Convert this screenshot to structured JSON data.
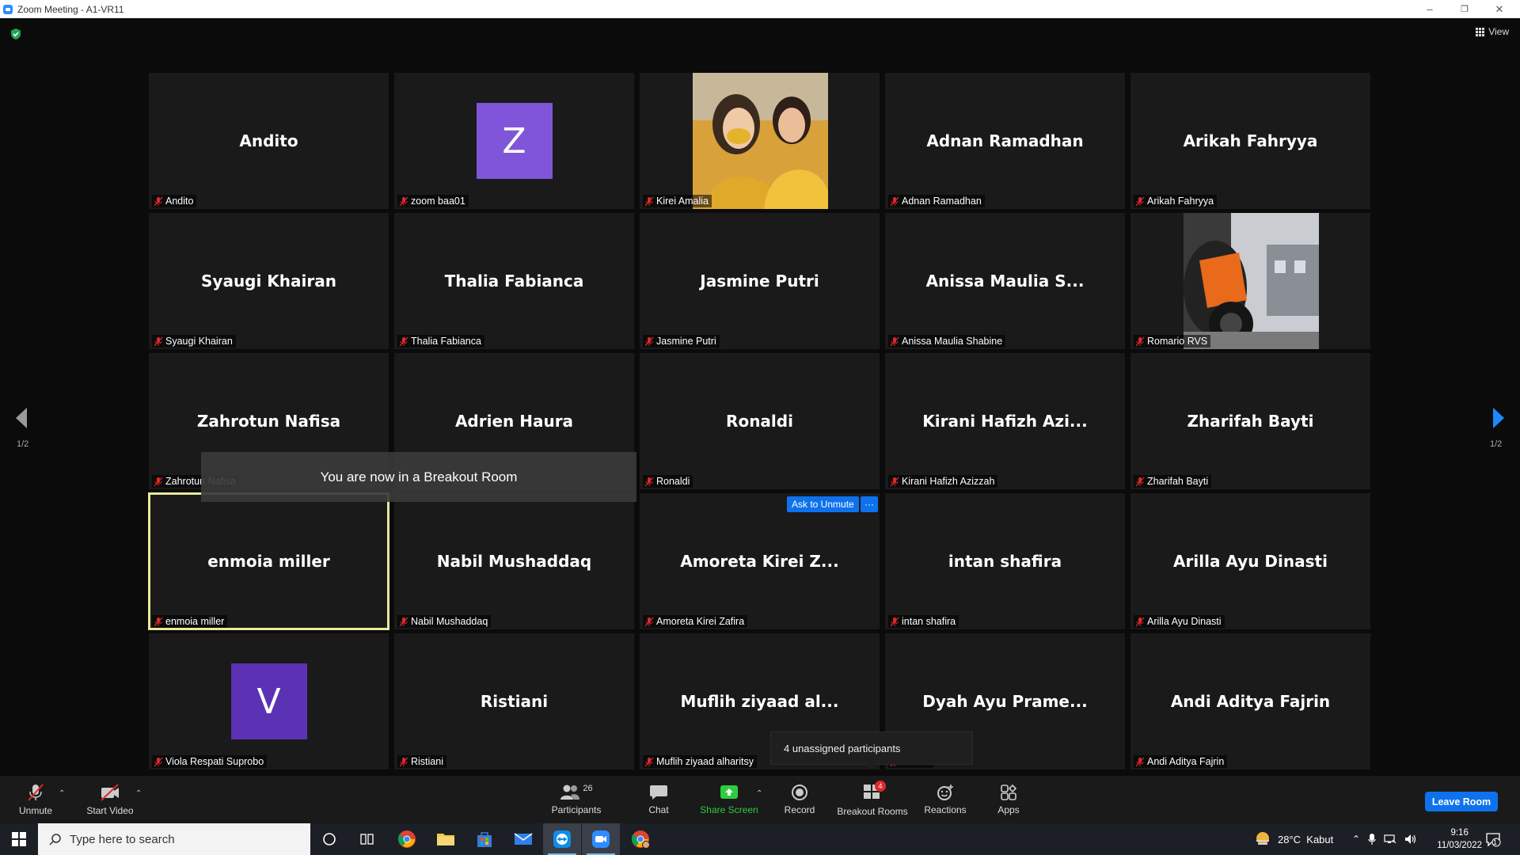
{
  "window": {
    "title": "Zoom Meeting - A1-VR11",
    "minimize": "–",
    "restore": "❐",
    "close": "✕"
  },
  "meeting": {
    "view_label": "View",
    "page_indicator_left": "1/2",
    "page_indicator_right": "1/2",
    "toast": "You are now in a Breakout Room",
    "ask_unmute": "Ask to Unmute",
    "ask_more": "···",
    "unassigned_tooltip": "4 unassigned participants"
  },
  "tiles": [
    {
      "big": "Andito",
      "label": "Andito"
    },
    {
      "big": "",
      "label": "zoom baa01",
      "avatar": "Z",
      "avatar_color": "#7f56d9"
    },
    {
      "big": "",
      "label": "Kirei Amalia",
      "photo": "portrait"
    },
    {
      "big": "Adnan Ramadhan",
      "label": "Adnan Ramadhan"
    },
    {
      "big": "Arikah Fahryya",
      "label": "Arikah Fahryya"
    },
    {
      "big": "Syaugi Khairan",
      "label": "Syaugi Khairan"
    },
    {
      "big": "Thalia Fabianca",
      "label": "Thalia Fabianca"
    },
    {
      "big": "Jasmine Putri",
      "label": "Jasmine Putri"
    },
    {
      "big": "Anissa Maulia S...",
      "label": "Anissa Maulia Shabine"
    },
    {
      "big": "",
      "label": "Romario RVS",
      "photo": "motorcycle"
    },
    {
      "big": "Zahrotun Nafisa",
      "label": "Zahrotun Nafisa"
    },
    {
      "big": "Adrien Haura",
      "label": ""
    },
    {
      "big": "Ronaldi",
      "label": "Ronaldi"
    },
    {
      "big": "Kirani Hafizh Azi...",
      "label": "Kirani Hafizh Azizzah"
    },
    {
      "big": "Zharifah Bayti",
      "label": "Zharifah Bayti"
    },
    {
      "big": "enmoia miller",
      "label": "enmoia miller",
      "active": true
    },
    {
      "big": "Nabil Mushaddaq",
      "label": "Nabil Mushaddaq"
    },
    {
      "big": "Amoreta Kirei Z...",
      "label": "Amoreta Kirei Zafira"
    },
    {
      "big": "intan shafira",
      "label": "intan shafira"
    },
    {
      "big": "Arilla Ayu Dinasti",
      "label": "Arilla Ayu Dinasti"
    },
    {
      "big": "",
      "label": "Viola Respati Suprobo",
      "avatar": "V",
      "avatar_color": "#5b32b4"
    },
    {
      "big": "Ristiani",
      "label": "Ristiani"
    },
    {
      "big": "Muflih ziyaad al...",
      "label": "Muflih ziyaad alharitsy"
    },
    {
      "big": "Dyah Ayu Prame...",
      "label": "eswari"
    },
    {
      "big": "Andi Aditya Fajrin",
      "label": "Andi Aditya Fajrin"
    }
  ],
  "toolbar": {
    "unmute": "Unmute",
    "start_video": "Start Video",
    "participants": "Participants",
    "participants_count": "26",
    "chat": "Chat",
    "share_screen": "Share Screen",
    "record": "Record",
    "breakout_rooms": "Breakout Rooms",
    "breakout_badge": "4",
    "reactions": "Reactions",
    "apps": "Apps",
    "leave_room": "Leave Room"
  },
  "taskbar": {
    "search_placeholder": "Type here to search",
    "weather": "28°C  Kabut",
    "time": "9:16",
    "date": "11/03/2022",
    "notification_count": "1"
  },
  "colors": {
    "accent": "#0e72ed",
    "share_green": "#2ecc40",
    "active_speaker": "#e7e99a",
    "muted_red": "#e02828"
  }
}
